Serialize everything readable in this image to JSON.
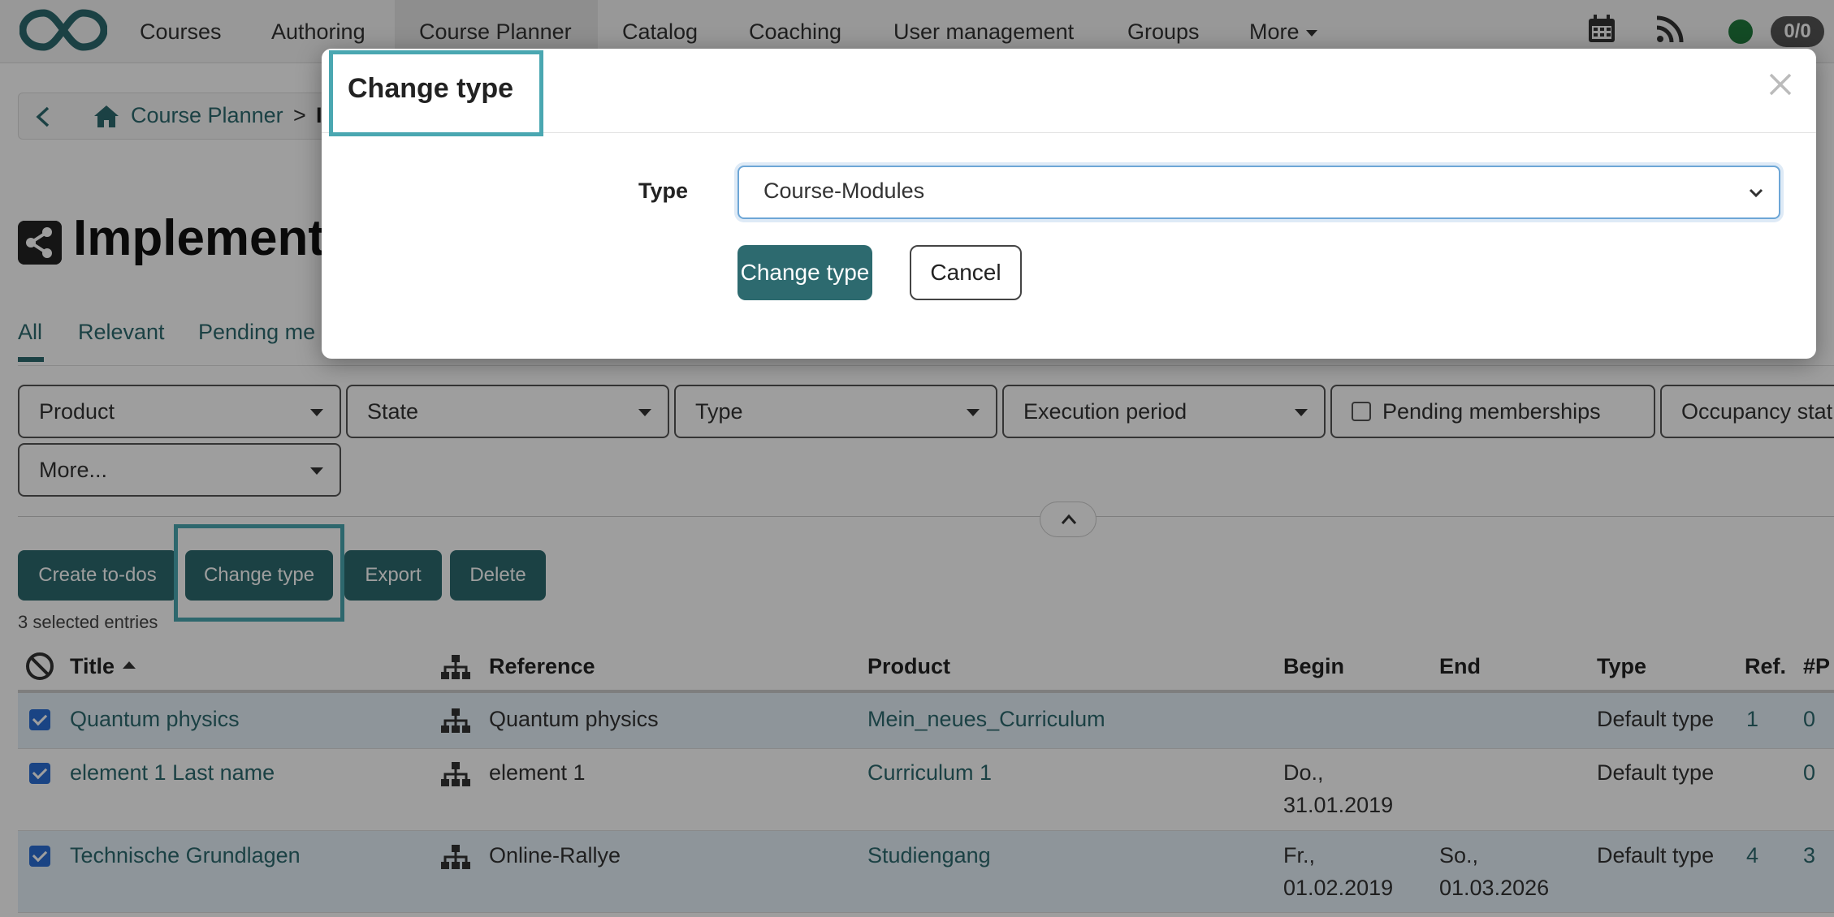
{
  "topnav": {
    "items": [
      {
        "label": "Courses"
      },
      {
        "label": "Authoring"
      },
      {
        "label": "Course Planner"
      },
      {
        "label": "Catalog"
      },
      {
        "label": "Coaching"
      },
      {
        "label": "User management"
      },
      {
        "label": "Groups"
      },
      {
        "label": "More"
      }
    ],
    "icons": [
      "calendar-icon",
      "rss-icon"
    ],
    "badge": "0/0",
    "status_color": "#1f7a3c"
  },
  "breadcrumb": {
    "parent": "Course Planner",
    "separator": ">",
    "current": "Im"
  },
  "page": {
    "title": "Implementa"
  },
  "tabs": [
    "All",
    "Relevant",
    "Pending me"
  ],
  "filters": {
    "row1": [
      "Product",
      "State",
      "Type",
      "Execution period",
      "Pending memberships",
      "Occupancy stat"
    ],
    "row2": [
      "More..."
    ]
  },
  "actions": [
    "Create to-dos",
    "Change type",
    "Export",
    "Delete"
  ],
  "selection": {
    "text": "3 selected entries"
  },
  "table": {
    "columns": [
      "Title",
      "Reference",
      "Product",
      "Begin",
      "End",
      "Type",
      "Ref.",
      "#P"
    ],
    "rows": [
      {
        "title": "Quantum physics",
        "reference": "Quantum physics",
        "product": "Mein_neues_Curriculum",
        "begin_1": "",
        "begin_2": "",
        "end_1": "",
        "end_2": "",
        "type": "Default type",
        "ref": "1",
        "p": "0"
      },
      {
        "title": "element 1 Last name",
        "reference": "element 1",
        "product": "Curriculum 1",
        "begin_1": "Do.,",
        "begin_2": "31.01.2019",
        "end_1": "",
        "end_2": "",
        "type": "Default type",
        "ref": "",
        "p": "0"
      },
      {
        "title": "Technische Grundlagen",
        "reference": "Online-Rallye",
        "product": "Studiengang",
        "begin_1": "Fr.,",
        "begin_2": "01.02.2019",
        "end_1": "So.,",
        "end_2": "01.03.2026",
        "type": "Default type",
        "ref": "4",
        "p": "3"
      }
    ]
  },
  "modal": {
    "title": "Change type",
    "type_label": "Type",
    "type_value": "Course-Modules",
    "primary_button": "Change type",
    "cancel_button": "Cancel"
  },
  "colors": {
    "accent": "#2d6a6f",
    "highlight": "#4aa7b1",
    "checkbox": "#2a6fd6"
  }
}
